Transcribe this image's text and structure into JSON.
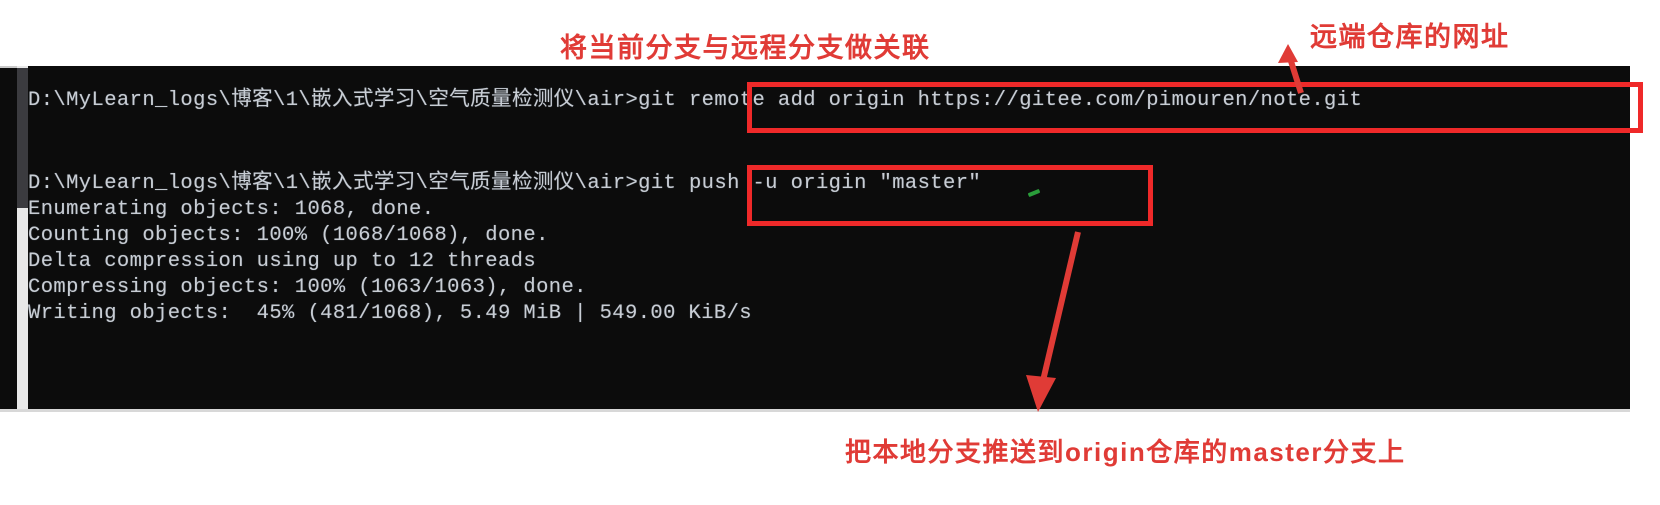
{
  "terminal": {
    "background_color": "#0c0c0c",
    "text_color": "#c8cdd4",
    "lines": [
      {
        "text": "D:\\MyLearn_logs\\博客\\1\\嵌入式学习\\空气质量检测仪\\air>git remote add origin https://gitee.com/pimouren/note.git"
      },
      {
        "text": ""
      },
      {
        "text": "D:\\MyLearn_logs\\博客\\1\\嵌入式学习\\空气质量检测仪\\air>git push -u origin \"master\""
      },
      {
        "text": "Enumerating objects: 1068, done."
      },
      {
        "text": "Counting objects: 100% (1068/1068), done."
      },
      {
        "text": "Delta compression using up to 12 threads"
      },
      {
        "text": "Compressing objects: 100% (1063/1063), done."
      },
      {
        "text": "Writing objects:  45% (481/1068), 5.49 MiB | 549.00 KiB/s"
      }
    ]
  },
  "annotations": {
    "color": "#e03b36",
    "remote_add_label": "将当前分支与远程分支做关联",
    "repo_url_label": "远端仓库的网址",
    "push_label": "把本地分支推送到origin仓库的master分支上"
  }
}
